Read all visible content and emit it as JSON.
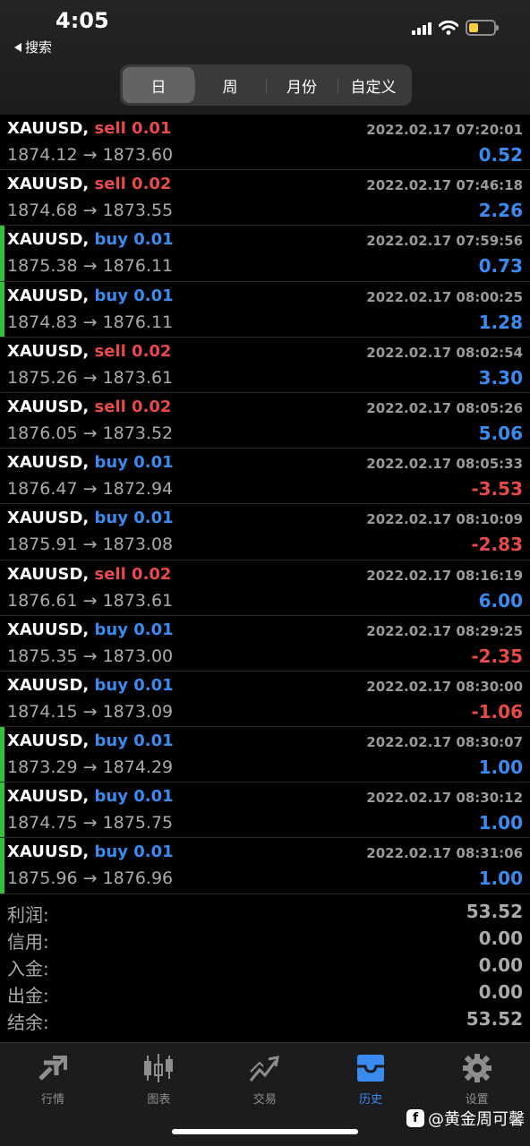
{
  "status": {
    "time": "4:05",
    "back_label": "搜索"
  },
  "segments": [
    {
      "label": "日",
      "active": true
    },
    {
      "label": "周",
      "active": false
    },
    {
      "label": "月份",
      "active": false
    },
    {
      "label": "自定义",
      "active": false
    }
  ],
  "trades": [
    {
      "symbol": "XAUUSD,",
      "action": "sell 0.01",
      "type": "sell",
      "datetime": "2022.02.17 07:20:01",
      "price": "1874.12 → 1873.60",
      "profit": "0.52",
      "sign": "pos",
      "marker": false
    },
    {
      "symbol": "XAUUSD,",
      "action": "sell 0.02",
      "type": "sell",
      "datetime": "2022.02.17 07:46:18",
      "price": "1874.68 → 1873.55",
      "profit": "2.26",
      "sign": "pos",
      "marker": false
    },
    {
      "symbol": "XAUUSD,",
      "action": "buy 0.01",
      "type": "buy",
      "datetime": "2022.02.17 07:59:56",
      "price": "1875.38 → 1876.11",
      "profit": "0.73",
      "sign": "pos",
      "marker": true
    },
    {
      "symbol": "XAUUSD,",
      "action": "buy 0.01",
      "type": "buy",
      "datetime": "2022.02.17 08:00:25",
      "price": "1874.83 → 1876.11",
      "profit": "1.28",
      "sign": "pos",
      "marker": true
    },
    {
      "symbol": "XAUUSD,",
      "action": "sell 0.02",
      "type": "sell",
      "datetime": "2022.02.17 08:02:54",
      "price": "1875.26 → 1873.61",
      "profit": "3.30",
      "sign": "pos",
      "marker": false
    },
    {
      "symbol": "XAUUSD,",
      "action": "sell 0.02",
      "type": "sell",
      "datetime": "2022.02.17 08:05:26",
      "price": "1876.05 → 1873.52",
      "profit": "5.06",
      "sign": "pos",
      "marker": false
    },
    {
      "symbol": "XAUUSD,",
      "action": "buy 0.01",
      "type": "buy",
      "datetime": "2022.02.17 08:05:33",
      "price": "1876.47 → 1872.94",
      "profit": "-3.53",
      "sign": "neg",
      "marker": false
    },
    {
      "symbol": "XAUUSD,",
      "action": "buy 0.01",
      "type": "buy",
      "datetime": "2022.02.17 08:10:09",
      "price": "1875.91 → 1873.08",
      "profit": "-2.83",
      "sign": "neg",
      "marker": false
    },
    {
      "symbol": "XAUUSD,",
      "action": "sell 0.02",
      "type": "sell",
      "datetime": "2022.02.17 08:16:19",
      "price": "1876.61 → 1873.61",
      "profit": "6.00",
      "sign": "pos",
      "marker": false
    },
    {
      "symbol": "XAUUSD,",
      "action": "buy 0.01",
      "type": "buy",
      "datetime": "2022.02.17 08:29:25",
      "price": "1875.35 → 1873.00",
      "profit": "-2.35",
      "sign": "neg",
      "marker": false
    },
    {
      "symbol": "XAUUSD,",
      "action": "buy 0.01",
      "type": "buy",
      "datetime": "2022.02.17 08:30:00",
      "price": "1874.15 → 1873.09",
      "profit": "-1.06",
      "sign": "neg",
      "marker": false
    },
    {
      "symbol": "XAUUSD,",
      "action": "buy 0.01",
      "type": "buy",
      "datetime": "2022.02.17 08:30:07",
      "price": "1873.29 → 1874.29",
      "profit": "1.00",
      "sign": "pos",
      "marker": true
    },
    {
      "symbol": "XAUUSD,",
      "action": "buy 0.01",
      "type": "buy",
      "datetime": "2022.02.17 08:30:12",
      "price": "1874.75 → 1875.75",
      "profit": "1.00",
      "sign": "pos",
      "marker": true
    },
    {
      "symbol": "XAUUSD,",
      "action": "buy 0.01",
      "type": "buy",
      "datetime": "2022.02.17 08:31:06",
      "price": "1875.96 → 1876.96",
      "profit": "1.00",
      "sign": "pos",
      "marker": true
    }
  ],
  "summary": [
    {
      "label": "利润:",
      "value": "53.52"
    },
    {
      "label": "信用:",
      "value": "0.00"
    },
    {
      "label": "入金:",
      "value": "0.00"
    },
    {
      "label": "出金:",
      "value": "0.00"
    },
    {
      "label": "结余:",
      "value": "53.52"
    }
  ],
  "tabs": [
    {
      "label": "行情",
      "icon": "quotes-icon",
      "active": false
    },
    {
      "label": "图表",
      "icon": "chart-icon",
      "active": false
    },
    {
      "label": "交易",
      "icon": "trade-icon",
      "active": false
    },
    {
      "label": "历史",
      "icon": "history-icon",
      "active": true
    },
    {
      "label": "设置",
      "icon": "gear-icon",
      "active": false
    }
  ],
  "watermark": "@黄金周可馨",
  "colors": {
    "sell": "#e84a4a",
    "buy": "#3a8bf0",
    "marker": "#35c03a",
    "active_tab": "#3a8bf0"
  }
}
